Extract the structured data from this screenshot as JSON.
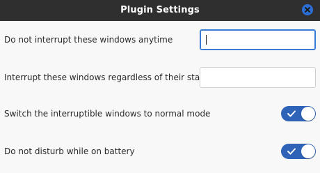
{
  "window": {
    "title": "Plugin Settings",
    "close_icon": "close-icon"
  },
  "settings": [
    {
      "label": "Do not interrupt these windows anytime",
      "control": "text-input",
      "value": "",
      "focused": true
    },
    {
      "label": "Interrupt these windows regardless of their state",
      "control": "text-input",
      "value": "",
      "focused": false
    },
    {
      "label": "Switch the interruptible windows to normal mode",
      "control": "toggle",
      "checked": true
    },
    {
      "label": "Do not disturb while on battery",
      "control": "toggle",
      "checked": true
    }
  ],
  "colors": {
    "titlebar": "#2f2f2f",
    "accent": "#2e63b8",
    "focus_border": "#3a7bd5"
  }
}
